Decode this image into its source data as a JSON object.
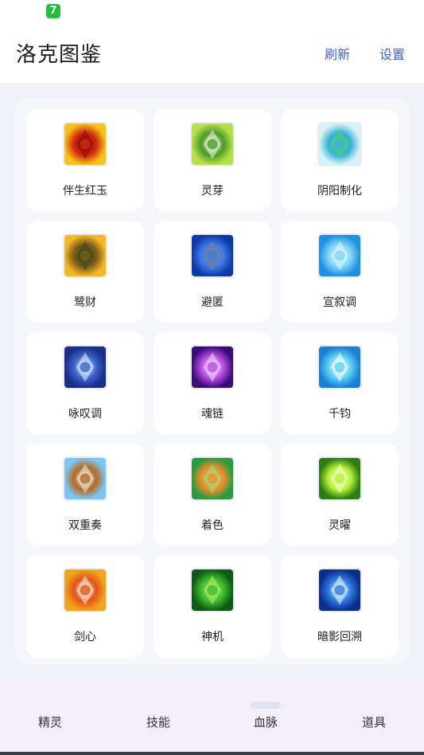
{
  "status_bar": {
    "app_icon_glyph": "7"
  },
  "header": {
    "title": "洛克图鉴",
    "refresh_label": "刷新",
    "settings_label": "设置"
  },
  "grid": {
    "items": [
      {
        "label": "伴生红玉",
        "icon": "red-gem-icon",
        "colors": [
          "#f7c21a",
          "#d02a10",
          "#8a0d05"
        ]
      },
      {
        "label": "灵芽",
        "icon": "sprout-icon",
        "colors": [
          "#b6e04a",
          "#4b9a2a",
          "#f0f4d8"
        ]
      },
      {
        "label": "阴阳制化",
        "icon": "yin-yang-swirl-icon",
        "colors": [
          "#d6f3f5",
          "#38b1d6",
          "#4ad07a"
        ]
      },
      {
        "label": "鹭财",
        "icon": "tree-coins-icon",
        "colors": [
          "#f5b724",
          "#7b5a1d",
          "#3b4a18"
        ]
      },
      {
        "label": "避匿",
        "icon": "hidden-stone-icon",
        "colors": [
          "#0e3aa8",
          "#3f7be8",
          "#7f7f8c"
        ]
      },
      {
        "label": "宣叙调",
        "icon": "music-note-icon",
        "colors": [
          "#1f8fe0",
          "#7fd6f7",
          "#dff6ff"
        ]
      },
      {
        "label": "咏叹调",
        "icon": "snowflake-icon",
        "colors": [
          "#1b2c8a",
          "#3a63c9",
          "#e6f0ff"
        ]
      },
      {
        "label": "魂链",
        "icon": "spirit-chain-icon",
        "colors": [
          "#3a0c7a",
          "#b64de0",
          "#f0d9ff"
        ]
      },
      {
        "label": "千钧",
        "icon": "water-orb-icon",
        "colors": [
          "#1c7fd4",
          "#5fd0f6",
          "#ffffff"
        ]
      },
      {
        "label": "双重奏",
        "icon": "duet-fighter-icon",
        "colors": [
          "#7cc6f5",
          "#b5691f",
          "#e8e8ee"
        ]
      },
      {
        "label": "着色",
        "icon": "paint-brush-icon",
        "colors": [
          "#2a9c3e",
          "#f08c2a",
          "#9ee07a"
        ]
      },
      {
        "label": "灵曜",
        "icon": "green-blades-icon",
        "colors": [
          "#2e7d12",
          "#b8f03a",
          "#f4ffc8"
        ]
      },
      {
        "label": "剑心",
        "icon": "crossed-swords-icon",
        "colors": [
          "#f2a41a",
          "#e3531a",
          "#f4f0d6"
        ]
      },
      {
        "label": "神机",
        "icon": "mech-spear-icon",
        "colors": [
          "#0f5a14",
          "#3cbd2c",
          "#b8e86a"
        ]
      },
      {
        "label": "暗影回溯",
        "icon": "shadow-rune-icon",
        "colors": [
          "#0b2e8c",
          "#2f78e0",
          "#e6fbff"
        ]
      }
    ]
  },
  "bottom_nav": {
    "active_index": 2,
    "items": [
      {
        "label": "精灵"
      },
      {
        "label": "技能"
      },
      {
        "label": "血脉"
      },
      {
        "label": "道具"
      }
    ]
  }
}
